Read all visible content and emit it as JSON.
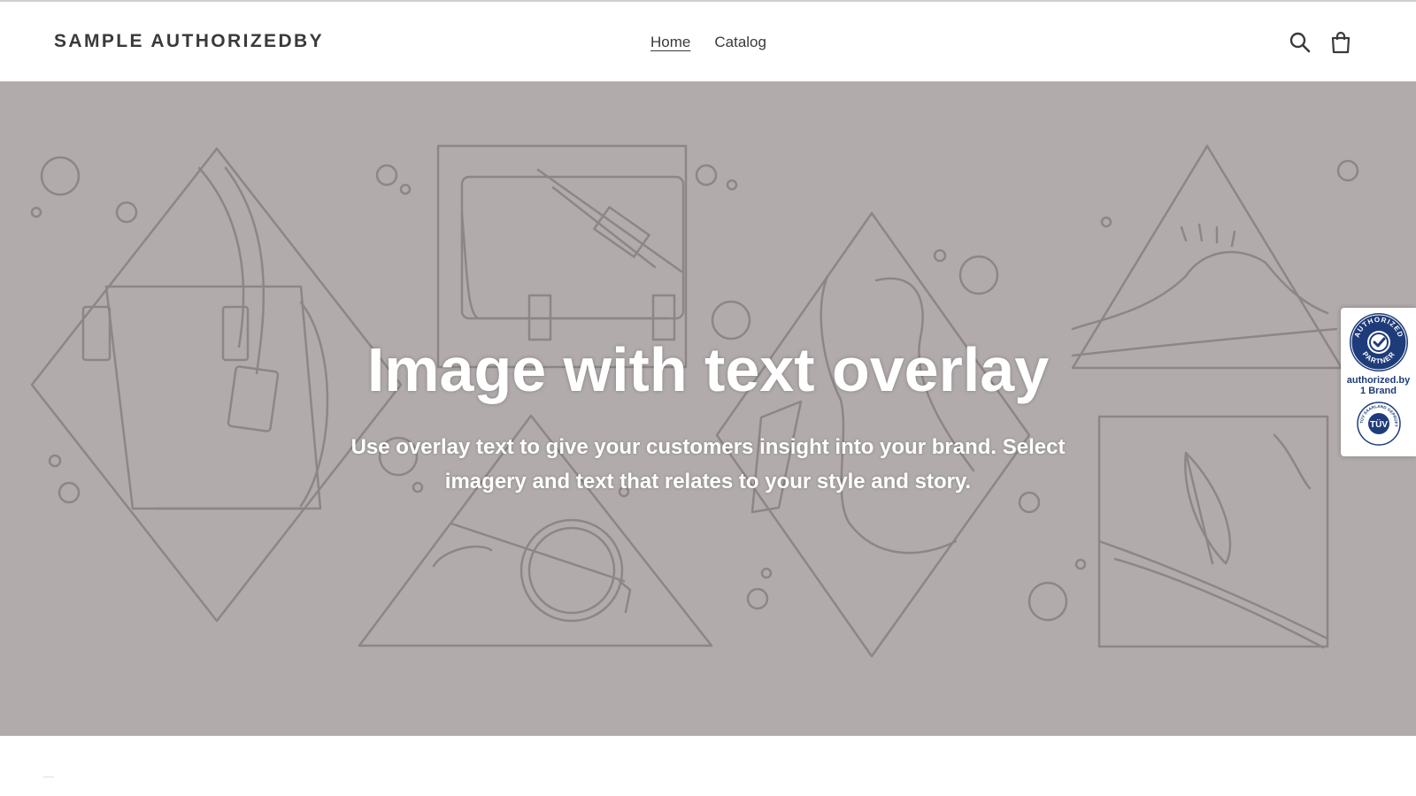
{
  "header": {
    "logo_text": "SAMPLE AUTHORIZEDBY",
    "nav": [
      {
        "label": "Home",
        "active": true
      },
      {
        "label": "Catalog",
        "active": false
      }
    ],
    "icons": [
      "search-icon",
      "cart-icon"
    ]
  },
  "hero": {
    "title": "Image with text overlay",
    "subtitle": "Use overlay text to give your customers insight into your brand. Select imagery and text that relates to your style and story.",
    "background_color": "#b1abab",
    "illustration_color": "#8e8686"
  },
  "trust_badge": {
    "seal_text": "AUTHORIZED PARTNER",
    "line1": "authorized.by",
    "line2": "1 Brand",
    "tuv_text": "TÜV",
    "tuv_ring_text": "TÜV SAARLAND GEPRÜFT",
    "brand_color": "#1e3c7a"
  }
}
